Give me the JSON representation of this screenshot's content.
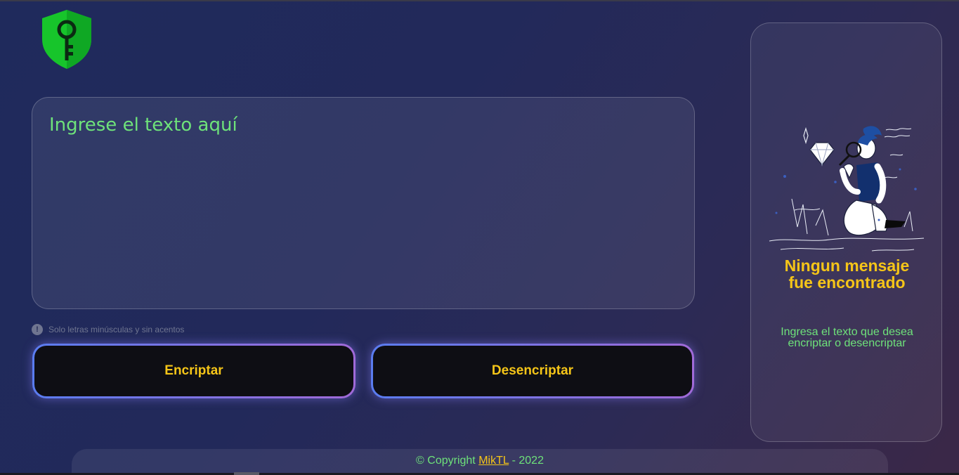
{
  "editor": {
    "placeholder": "Ingrese el texto aquí",
    "value": ""
  },
  "hint": {
    "icon": "exclamation-icon",
    "glyph": "!",
    "text": "Solo letras minúsculas y sin acentos"
  },
  "buttons": {
    "encrypt_label": "Encriptar",
    "decrypt_label": "Desencriptar"
  },
  "result_panel": {
    "title_line1": "Ningun mensaje",
    "title_line2": "fue encontrado",
    "subtitle": "Ingresa el texto que desea encriptar o desencriptar"
  },
  "footer": {
    "prefix": "© Copyright ",
    "author_link": "MikTL",
    "suffix": " - 2022"
  },
  "colors": {
    "accent_yellow": "#f5c518",
    "text_green": "#6ee27a",
    "logo_green": "#1fbf2e",
    "button_border_start": "#5a7cf0",
    "button_border_end": "#a06ad8"
  }
}
